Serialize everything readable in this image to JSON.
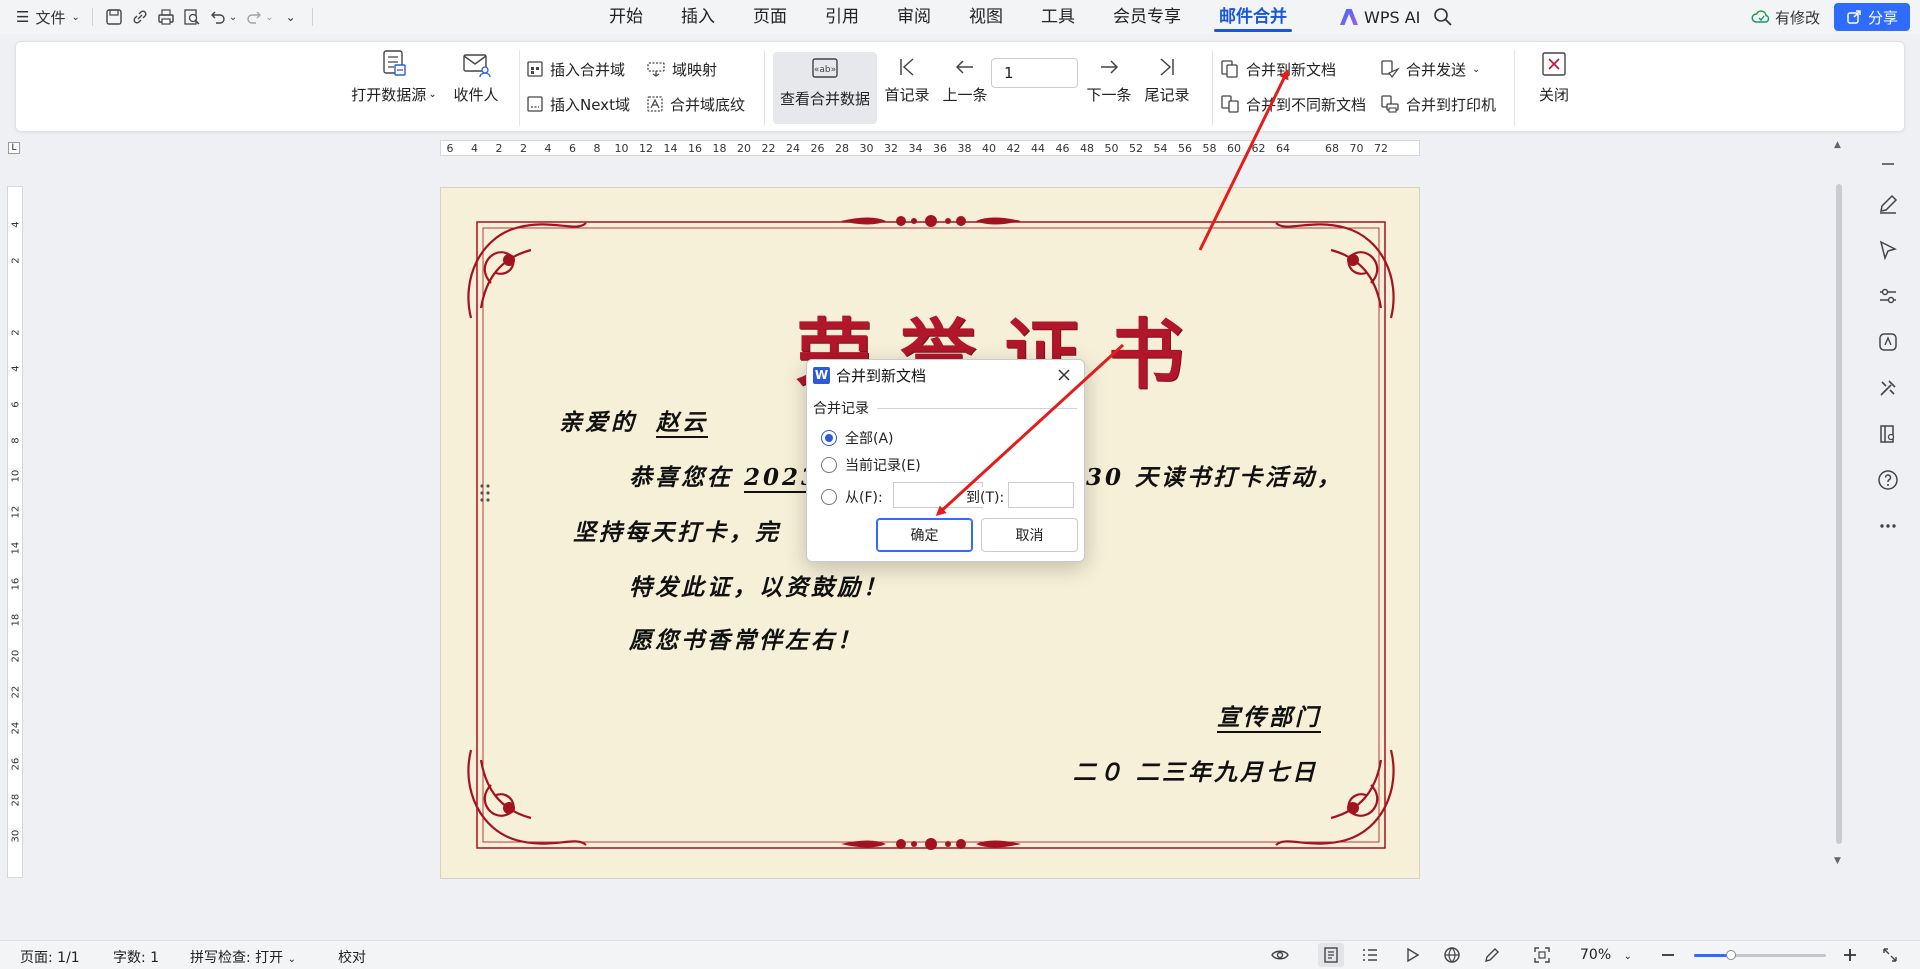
{
  "menubar": {
    "file_label": "文件",
    "tabs": [
      "开始",
      "插入",
      "页面",
      "引用",
      "审阅",
      "视图",
      "工具",
      "会员专享",
      "邮件合并"
    ],
    "active_tab": "邮件合并",
    "wps_ai_label": "WPS AI",
    "modified_label": "有修改",
    "share_label": "分享"
  },
  "ribbon": {
    "open_datasource": "打开数据源",
    "recipients": "收件人",
    "insert_merge_field": "插入合并域",
    "field_mapping": "域映射",
    "insert_next_field": "插入Next域",
    "merge_field_shading": "合并域底纹",
    "view_merged_data": "查看合并数据",
    "first_record": "首记录",
    "prev_record": "上一条",
    "record_number": "1",
    "next_record": "下一条",
    "last_record": "尾记录",
    "merge_to_new_doc": "合并到新文档",
    "merge_to_separate_docs": "合并到不同新文档",
    "merge_send": "合并发送",
    "merge_to_printer": "合并到打印机",
    "close": "关闭"
  },
  "ruler": {
    "ticks": [
      "6",
      "4",
      "2",
      "2",
      "4",
      "6",
      "8",
      "10",
      "12",
      "14",
      "16",
      "18",
      "20",
      "22",
      "24",
      "26",
      "28",
      "30",
      "32",
      "34",
      "36",
      "38",
      "40",
      "42",
      "44",
      "46",
      "48",
      "50",
      "52",
      "54",
      "56",
      "58",
      "60",
      "62",
      "64",
      "68",
      "70",
      "72"
    ],
    "vticks": [
      "4",
      "2",
      "2",
      "4",
      "6",
      "8",
      "10",
      "12",
      "14",
      "16",
      "18",
      "20",
      "22",
      "24",
      "26",
      "28",
      "30"
    ]
  },
  "document": {
    "title": "荣誉证书",
    "greeting_prefix": "亲爱的",
    "recipient_name": "赵云",
    "line1_prefix": "恭喜您在",
    "line1_year": "2023",
    "line1_suffix": "30 天读书打卡活动，",
    "line2": "坚持每天打卡，完",
    "line3": "特发此证，以资鼓励！",
    "line4": "愿您书香常伴左右！",
    "department": "宣传部门",
    "date": "二０ 二三年九月七日"
  },
  "dialog": {
    "title": "合并到新文档",
    "group_label": "合并记录",
    "option_all": "全部(A)",
    "option_current": "当前记录(E)",
    "option_from": "从(F):",
    "to_label": "到(T):",
    "from_value": "",
    "to_value": "",
    "ok_label": "确定",
    "cancel_label": "取消",
    "selected_option": "all"
  },
  "statusbar": {
    "page": "页面: 1/1",
    "word_count": "字数: 1",
    "spell_check": "拼写检查: 打开",
    "proofread": "校对",
    "zoom": "70%",
    "zoom_fraction": 0.28
  },
  "colors": {
    "accent": "#1a56db",
    "share_button": "#2f6bff",
    "certificate_red": "#b2162a",
    "page_bg": "#f6f0d8",
    "arrow_red": "#e31c1c"
  }
}
